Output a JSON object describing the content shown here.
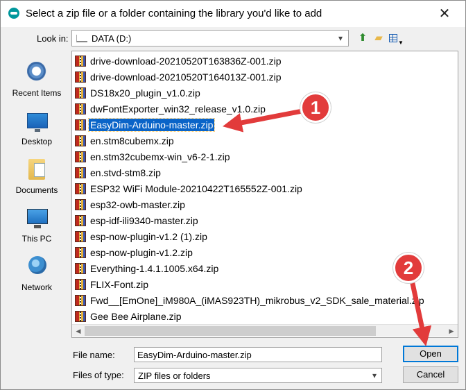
{
  "window": {
    "title": "Select a zip file or a folder containing the library you'd like to add",
    "close_glyph": "✕"
  },
  "toolbar": {
    "lookin_label": "Look in:",
    "lookin_value": "DATA (D:)",
    "up_icon": "folder-up-icon",
    "new_folder_icon": "new-folder-icon",
    "view_menu_icon": "view-menu-icon"
  },
  "places": [
    {
      "label": "Recent Items",
      "icon": "recent-items-icon"
    },
    {
      "label": "Desktop",
      "icon": "desktop-icon"
    },
    {
      "label": "Documents",
      "icon": "documents-icon"
    },
    {
      "label": "This PC",
      "icon": "this-pc-icon"
    },
    {
      "label": "Network",
      "icon": "network-icon"
    }
  ],
  "files": [
    "drive-download-20210520T163836Z-001.zip",
    "drive-download-20210520T164013Z-001.zip",
    "DS18x20_plugin_v1.0.zip",
    "dwFontExporter_win32_release_v1.0.zip",
    "EasyDim-Arduino-master.zip",
    "en.stm8cubemx.zip",
    "en.stm32cubemx-win_v6-2-1.zip",
    "en.stvd-stm8.zip",
    "ESP32 WiFi Module-20210422T165552Z-001.zip",
    "esp32-owb-master.zip",
    "esp-idf-ili9340-master.zip",
    "esp-now-plugin-v1.2 (1).zip",
    "esp-now-plugin-v1.2.zip",
    "Everything-1.4.1.1005.x64.zip",
    "FLIX-Font.zip",
    "Fwd__[EmOne]_iM980A_(iMAS923TH)_mikrobus_v2_SDK_sale_material.zip",
    "Gee Bee Airplane.zip"
  ],
  "selected_file": "EasyDim-Arduino-master.zip",
  "form": {
    "file_name_label": "File name:",
    "file_name_value": "EasyDim-Arduino-master.zip",
    "file_type_label": "Files of type:",
    "file_type_value": "ZIP files or folders"
  },
  "buttons": {
    "open": "Open",
    "cancel": "Cancel"
  },
  "annotations": {
    "badge_1": "1",
    "badge_2": "2",
    "color": "#e23b3b"
  },
  "scroll": {
    "left_glyph": "◀",
    "right_glyph": "▶"
  }
}
